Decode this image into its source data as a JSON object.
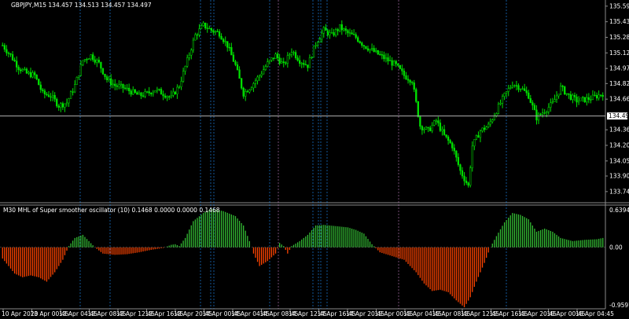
{
  "header": {
    "main_title": "GBPJPY,M15  134.457 134.513 134.457 134.497",
    "indicator_title": "M30 MHL of Super smoother oscillator (10) 0.1468 0.0000 0.0000 0.1468"
  },
  "price_axis": {
    "labels": [
      "135.590",
      "135.435",
      "135.280",
      "135.125",
      "134.970",
      "134.820",
      "134.665",
      "134.360",
      "134.205",
      "134.050",
      "133.900",
      "133.745"
    ],
    "current_price": "134.497"
  },
  "indicator_axis": {
    "labels": [
      "0.6394",
      "0.00",
      "-0.9597"
    ]
  },
  "time_axis": {
    "labels": [
      "10 Apr 2020",
      "13 Apr 00:45",
      "13 Apr 04:45",
      "13 Apr 08:45",
      "13 Apr 12:45",
      "13 Apr 16:45",
      "13 Apr 20:45",
      "14 Apr 00:45",
      "14 Apr 04:45",
      "14 Apr 08:45",
      "14 Apr 12:45",
      "14 Apr 16:45",
      "14 Apr 20:45",
      "15 Apr 00:45",
      "15 Apr 04:45",
      "15 Apr 08:45",
      "15 Apr 12:45",
      "15 Apr 16:45",
      "15 Apr 20:45",
      "16 Apr 00:45",
      "16 Apr 04:45"
    ]
  },
  "colors": {
    "bull": "#00e000",
    "bear": "#00e000",
    "osc_pos": "#33bb33",
    "osc_neg": "#ff4400",
    "sep_line": "#1e90ff",
    "sep_line_alt": "#c080c0"
  },
  "chart_data": [
    {
      "type": "candlestick",
      "title": "GBPJPY,M15  134.457 134.513 134.457 134.497",
      "ylim": [
        133.65,
        135.62
      ],
      "current_price": 134.497,
      "key_points": [
        [
          0,
          135.2
        ],
        [
          4,
          135.1
        ],
        [
          8,
          134.98
        ],
        [
          12,
          134.92
        ],
        [
          16,
          134.9
        ],
        [
          20,
          134.72
        ],
        [
          24,
          134.7
        ],
        [
          28,
          134.6
        ],
        [
          32,
          134.63
        ],
        [
          36,
          134.8
        ],
        [
          40,
          135.05
        ],
        [
          44,
          135.1
        ],
        [
          48,
          135.02
        ],
        [
          52,
          134.86
        ],
        [
          56,
          134.8
        ],
        [
          60,
          134.78
        ],
        [
          64,
          134.74
        ],
        [
          68,
          134.7
        ],
        [
          72,
          134.72
        ],
        [
          76,
          134.76
        ],
        [
          80,
          134.72
        ],
        [
          84,
          134.68
        ],
        [
          88,
          134.8
        ],
        [
          92,
          135.05
        ],
        [
          96,
          135.3
        ],
        [
          100,
          135.4
        ],
        [
          104,
          135.35
        ],
        [
          108,
          135.32
        ],
        [
          112,
          135.2
        ],
        [
          116,
          135.0
        ],
        [
          120,
          134.72
        ],
        [
          124,
          134.8
        ],
        [
          128,
          134.9
        ],
        [
          132,
          135.02
        ],
        [
          136,
          135.1
        ],
        [
          140,
          135.0
        ],
        [
          144,
          135.15
        ],
        [
          148,
          135.05
        ],
        [
          152,
          135.0
        ],
        [
          156,
          135.22
        ],
        [
          160,
          135.35
        ],
        [
          164,
          135.3
        ],
        [
          168,
          135.38
        ],
        [
          172,
          135.32
        ],
        [
          176,
          135.28
        ],
        [
          180,
          135.2
        ],
        [
          184,
          135.15
        ],
        [
          188,
          135.1
        ],
        [
          192,
          135.05
        ],
        [
          196,
          135.0
        ],
        [
          200,
          134.9
        ],
        [
          204,
          134.85
        ],
        [
          208,
          134.4
        ],
        [
          212,
          134.35
        ],
        [
          216,
          134.45
        ],
        [
          220,
          134.3
        ],
        [
          224,
          134.2
        ],
        [
          228,
          133.95
        ],
        [
          232,
          133.8
        ],
        [
          234,
          134.2
        ],
        [
          238,
          134.35
        ],
        [
          242,
          134.4
        ],
        [
          246,
          134.55
        ],
        [
          250,
          134.7
        ],
        [
          254,
          134.82
        ],
        [
          258,
          134.78
        ],
        [
          262,
          134.7
        ],
        [
          266,
          134.48
        ],
        [
          270,
          134.55
        ],
        [
          274,
          134.62
        ],
        [
          278,
          134.78
        ],
        [
          282,
          134.7
        ],
        [
          286,
          134.65
        ],
        [
          290,
          134.66
        ],
        [
          294,
          134.68
        ],
        [
          299,
          134.72
        ]
      ]
    },
    {
      "type": "bar",
      "title": "M30 MHL of Super smoother oscillator (10) 0.1468 0.0000 0.0000 0.1468",
      "ylim": [
        -0.9597,
        0.6394
      ],
      "key_points": [
        [
          0,
          -0.18
        ],
        [
          6,
          -0.42
        ],
        [
          10,
          -0.48
        ],
        [
          14,
          -0.45
        ],
        [
          18,
          -0.48
        ],
        [
          22,
          -0.55
        ],
        [
          26,
          -0.4
        ],
        [
          30,
          -0.2
        ],
        [
          33,
          0.02
        ],
        [
          36,
          0.15
        ],
        [
          40,
          0.2
        ],
        [
          43,
          0.1
        ],
        [
          46,
          0.0
        ],
        [
          50,
          -0.1
        ],
        [
          56,
          -0.12
        ],
        [
          62,
          -0.11
        ],
        [
          68,
          -0.08
        ],
        [
          74,
          -0.04
        ],
        [
          80,
          -0.01
        ],
        [
          84,
          0.04
        ],
        [
          86,
          0.05
        ],
        [
          88,
          0.02
        ],
        [
          91,
          0.15
        ],
        [
          95,
          0.42
        ],
        [
          100,
          0.55
        ],
        [
          104,
          0.62
        ],
        [
          110,
          0.58
        ],
        [
          116,
          0.5
        ],
        [
          120,
          0.35
        ],
        [
          123,
          0.1
        ],
        [
          125,
          -0.1
        ],
        [
          128,
          -0.3
        ],
        [
          132,
          -0.22
        ],
        [
          136,
          -0.1
        ],
        [
          138,
          0.07
        ],
        [
          140,
          0.02
        ],
        [
          142,
          -0.1
        ],
        [
          144,
          0.02
        ],
        [
          148,
          0.1
        ],
        [
          152,
          0.2
        ],
        [
          156,
          0.35
        ],
        [
          160,
          0.36
        ],
        [
          166,
          0.34
        ],
        [
          172,
          0.32
        ],
        [
          176,
          0.28
        ],
        [
          180,
          0.22
        ],
        [
          184,
          0.05
        ],
        [
          188,
          -0.08
        ],
        [
          194,
          -0.14
        ],
        [
          200,
          -0.2
        ],
        [
          206,
          -0.4
        ],
        [
          210,
          -0.58
        ],
        [
          214,
          -0.7
        ],
        [
          218,
          -0.68
        ],
        [
          222,
          -0.72
        ],
        [
          226,
          -0.85
        ],
        [
          230,
          -0.96
        ],
        [
          233,
          -0.8
        ],
        [
          236,
          -0.55
        ],
        [
          240,
          -0.25
        ],
        [
          243,
          0.0
        ],
        [
          246,
          0.18
        ],
        [
          250,
          0.4
        ],
        [
          254,
          0.55
        ],
        [
          258,
          0.52
        ],
        [
          262,
          0.45
        ],
        [
          266,
          0.25
        ],
        [
          270,
          0.3
        ],
        [
          274,
          0.25
        ],
        [
          278,
          0.15
        ],
        [
          284,
          0.1
        ],
        [
          290,
          0.12
        ],
        [
          296,
          0.13
        ],
        [
          299,
          0.15
        ]
      ]
    }
  ]
}
